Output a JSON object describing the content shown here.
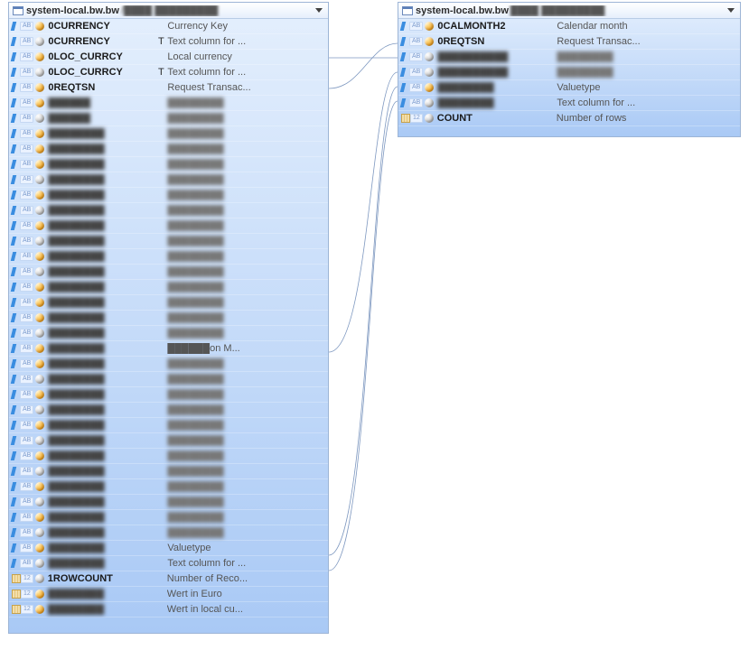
{
  "left": {
    "title_prefix": "system-local.bw.bw",
    "rows": [
      {
        "icon": "blue",
        "badge": "AB",
        "dot": "gold",
        "key": "0CURRENCY",
        "suffix": "",
        "desc": "Currency Key",
        "clear": true
      },
      {
        "icon": "blue",
        "badge": "AB",
        "dot": "gray",
        "key": "0CURRENCY",
        "suffix": "T",
        "desc": "Text column for ...",
        "clear": true
      },
      {
        "icon": "blue",
        "badge": "AB",
        "dot": "gold",
        "key": "0LOC_CURRCY",
        "suffix": "",
        "desc": "Local currency",
        "clear": true
      },
      {
        "icon": "blue",
        "badge": "AB",
        "dot": "gray",
        "key": "0LOC_CURRCY",
        "suffix": "T",
        "desc": "Text column for ...",
        "clear": true
      },
      {
        "icon": "blue",
        "badge": "AB",
        "dot": "gold",
        "key": "0REQTSN",
        "suffix": "",
        "desc": "Request Transac...",
        "clear": true
      },
      {
        "icon": "blue",
        "badge": "AB",
        "dot": "gold",
        "key": "██████",
        "suffix": "",
        "desc": "████████",
        "clear": false
      },
      {
        "icon": "blue",
        "badge": "AB",
        "dot": "gray",
        "key": "██████",
        "suffix": "",
        "desc": "████████",
        "clear": false
      },
      {
        "icon": "blue",
        "badge": "AB",
        "dot": "gold",
        "key": "████████",
        "suffix": "",
        "desc": "████████",
        "clear": false
      },
      {
        "icon": "blue",
        "badge": "AB",
        "dot": "gold",
        "key": "████████",
        "suffix": "",
        "desc": "████████",
        "clear": false
      },
      {
        "icon": "blue",
        "badge": "AB",
        "dot": "gold",
        "key": "████████",
        "suffix": "",
        "desc": "████████",
        "clear": false
      },
      {
        "icon": "blue",
        "badge": "AB",
        "dot": "gray",
        "key": "████████",
        "suffix": "",
        "desc": "████████",
        "clear": false
      },
      {
        "icon": "blue",
        "badge": "AB",
        "dot": "gold",
        "key": "████████",
        "suffix": "",
        "desc": "████████",
        "clear": false
      },
      {
        "icon": "blue",
        "badge": "AB",
        "dot": "gray",
        "key": "████████",
        "suffix": "",
        "desc": "████████",
        "clear": false
      },
      {
        "icon": "blue",
        "badge": "AB",
        "dot": "gold",
        "key": "████████",
        "suffix": "",
        "desc": "████████",
        "clear": false
      },
      {
        "icon": "blue",
        "badge": "AB",
        "dot": "gray",
        "key": "████████",
        "suffix": "",
        "desc": "████████",
        "clear": false
      },
      {
        "icon": "blue",
        "badge": "AB",
        "dot": "gold",
        "key": "████████",
        "suffix": "",
        "desc": "████████",
        "clear": false
      },
      {
        "icon": "blue",
        "badge": "AB",
        "dot": "gray",
        "key": "████████",
        "suffix": "",
        "desc": "████████",
        "clear": false
      },
      {
        "icon": "blue",
        "badge": "AB",
        "dot": "gold",
        "key": "████████",
        "suffix": "",
        "desc": "████████",
        "clear": false
      },
      {
        "icon": "blue",
        "badge": "AB",
        "dot": "gold",
        "key": "████████",
        "suffix": "",
        "desc": "████████",
        "clear": false
      },
      {
        "icon": "blue",
        "badge": "AB",
        "dot": "gold",
        "key": "████████",
        "suffix": "",
        "desc": "████████",
        "clear": false
      },
      {
        "icon": "blue",
        "badge": "AB",
        "dot": "gray",
        "key": "████████",
        "suffix": "",
        "desc": "████████",
        "clear": false
      },
      {
        "icon": "blue",
        "badge": "AB",
        "dot": "gold",
        "key": "████████",
        "suffix": "",
        "desc": "██████on M...",
        "clear": false,
        "descTail": "on M..."
      },
      {
        "icon": "blue",
        "badge": "AB",
        "dot": "gold",
        "key": "████████",
        "suffix": "",
        "desc": "████████",
        "clear": false
      },
      {
        "icon": "blue",
        "badge": "AB",
        "dot": "gray",
        "key": "████████",
        "suffix": "",
        "desc": "████████",
        "clear": false
      },
      {
        "icon": "blue",
        "badge": "AB",
        "dot": "gold",
        "key": "████████",
        "suffix": "",
        "desc": "████████",
        "clear": false
      },
      {
        "icon": "blue",
        "badge": "AB",
        "dot": "gray",
        "key": "████████",
        "suffix": "",
        "desc": "████████",
        "clear": false
      },
      {
        "icon": "blue",
        "badge": "AB",
        "dot": "gold",
        "key": "████████",
        "suffix": "",
        "desc": "████████",
        "clear": false
      },
      {
        "icon": "blue",
        "badge": "AB",
        "dot": "gray",
        "key": "████████",
        "suffix": "",
        "desc": "████████",
        "clear": false
      },
      {
        "icon": "blue",
        "badge": "AB",
        "dot": "gold",
        "key": "████████",
        "suffix": "",
        "desc": "████████",
        "clear": false
      },
      {
        "icon": "blue",
        "badge": "AB",
        "dot": "gray",
        "key": "████████",
        "suffix": "",
        "desc": "████████",
        "clear": false
      },
      {
        "icon": "blue",
        "badge": "AB",
        "dot": "gold",
        "key": "████████",
        "suffix": "",
        "desc": "████████",
        "clear": false
      },
      {
        "icon": "blue",
        "badge": "AB",
        "dot": "gray",
        "key": "████████",
        "suffix": "",
        "desc": "████████",
        "clear": false
      },
      {
        "icon": "blue",
        "badge": "AB",
        "dot": "gold",
        "key": "████████",
        "suffix": "",
        "desc": "████████",
        "clear": false
      },
      {
        "icon": "blue",
        "badge": "AB",
        "dot": "gray",
        "key": "████████",
        "suffix": "",
        "desc": "████████",
        "clear": false
      },
      {
        "icon": "blue",
        "badge": "AB",
        "dot": "gold",
        "key": "████████",
        "suffix": "",
        "desc": "Valuetype",
        "clear": false,
        "descClear": "Valuetype"
      },
      {
        "icon": "blue",
        "badge": "AB",
        "dot": "gray",
        "key": "████████",
        "suffix": "",
        "desc": "Text column for ...",
        "clear": false,
        "descClear": "Text column for ..."
      },
      {
        "icon": "ruler",
        "badge": "12",
        "dot": "gray",
        "key": "1ROWCOUNT",
        "suffix": "",
        "desc": "Number of Reco...",
        "clear": true
      },
      {
        "icon": "ruler",
        "badge": "12",
        "dot": "gold",
        "key": "████████",
        "suffix": "",
        "desc": "Wert in Euro",
        "clear": false,
        "descClear": "Wert in Euro"
      },
      {
        "icon": "ruler",
        "badge": "12",
        "dot": "gold",
        "key": "████████",
        "suffix": "",
        "desc": "Wert in local cu...",
        "clear": false,
        "descClear": "Wert in local cu..."
      }
    ]
  },
  "right": {
    "title_prefix": "system-local.bw.bw",
    "rows": [
      {
        "icon": "blue",
        "badge": "AB",
        "dot": "gold",
        "key": "0CALMONTH2",
        "suffix": "",
        "desc": "Calendar month",
        "clear": true
      },
      {
        "icon": "blue",
        "badge": "AB",
        "dot": "gold",
        "key": "0REQTSN",
        "suffix": "",
        "desc": "Request Transac...",
        "clear": true
      },
      {
        "icon": "blue",
        "badge": "AB",
        "dot": "gray",
        "key": "██████████",
        "suffix": "",
        "desc": "████████",
        "clear": false
      },
      {
        "icon": "blue",
        "badge": "AB",
        "dot": "gray",
        "key": "██████████",
        "suffix": "",
        "desc": "████████",
        "clear": false
      },
      {
        "icon": "blue",
        "badge": "AB",
        "dot": "gold",
        "key": "████████",
        "suffix": "",
        "desc": "Valuetype",
        "clear": false,
        "descClear": "Valuetype"
      },
      {
        "icon": "blue",
        "badge": "AB",
        "dot": "gray",
        "key": "████████",
        "suffix": "",
        "desc": "Text column for ...",
        "clear": false,
        "descClear": "Text column for ..."
      },
      {
        "icon": "ruler",
        "badge": "12",
        "dot": "gray",
        "key": "COUNT",
        "suffix": "",
        "desc": "Number of rows",
        "clear": true
      }
    ]
  }
}
